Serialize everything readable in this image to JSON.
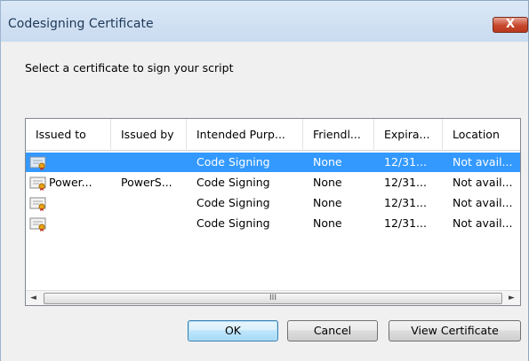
{
  "window": {
    "title": "Codesigning Certificate",
    "close_label": "X"
  },
  "prompt": "Select a certificate to sign your script",
  "columns": [
    "Issued to",
    "Issued by",
    "Intended Purp...",
    "Friendl...",
    "Expira...",
    "Location"
  ],
  "rows": [
    {
      "issued_to": "",
      "issued_by": "",
      "purpose": "Code Signing",
      "friendly": "None",
      "expiration": "12/31...",
      "location": "Not avail...",
      "selected": true
    },
    {
      "issued_to": "Power...",
      "issued_by": "PowerS...",
      "purpose": "Code Signing",
      "friendly": "None",
      "expiration": "12/31...",
      "location": "Not avail...",
      "selected": false
    },
    {
      "issued_to": "",
      "issued_by": "",
      "purpose": "Code Signing",
      "friendly": "None",
      "expiration": "12/31...",
      "location": "Not avail...",
      "selected": false
    },
    {
      "issued_to": "",
      "issued_by": "",
      "purpose": "Code Signing",
      "friendly": "None",
      "expiration": "12/31...",
      "location": "Not avail...",
      "selected": false
    }
  ],
  "scrollbar": {
    "left_arrow": "◄",
    "right_arrow": "►",
    "thumb_grip": "III"
  },
  "buttons": {
    "ok": "OK",
    "cancel": "Cancel",
    "view_certificate": "View Certificate"
  },
  "colors": {
    "selection": "#3399ff",
    "title_text": "#1e3957",
    "close_button": "#c7472c"
  },
  "icons": {
    "row_icon": "certificate-icon"
  }
}
